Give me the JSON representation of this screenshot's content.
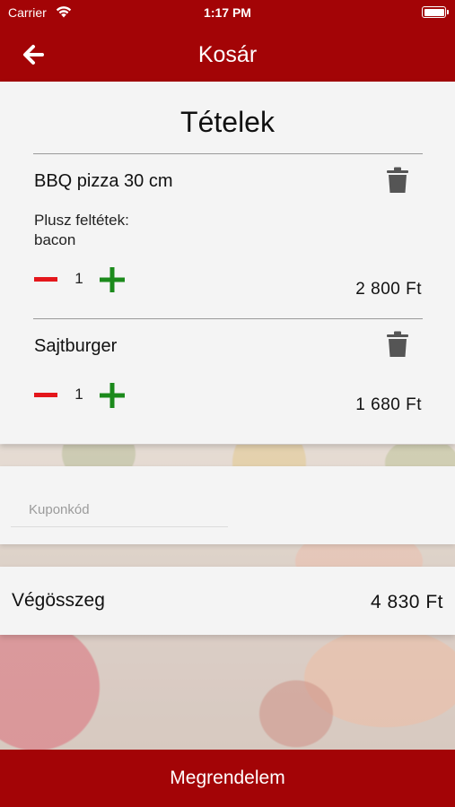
{
  "status_bar": {
    "carrier": "Carrier",
    "time": "1:17 PM"
  },
  "header": {
    "title": "Kosár"
  },
  "cart": {
    "title": "Tételek",
    "items": [
      {
        "name": "BBQ pizza 30 cm",
        "extras_label": "Plusz feltétek:",
        "extras_value": "bacon",
        "quantity": "1",
        "price": "2 800 Ft"
      },
      {
        "name": "Sajtburger",
        "quantity": "1",
        "price": "1 680 Ft"
      }
    ]
  },
  "coupon": {
    "placeholder": "Kuponkód"
  },
  "total": {
    "label": "Végösszeg",
    "value": "4 830 Ft"
  },
  "order_button": {
    "label": "Megrendelem"
  },
  "colors": {
    "brand_red": "#a30406",
    "minus_red": "#e4161b",
    "plus_green": "#1b8a1b",
    "trash_gray": "#555555"
  }
}
